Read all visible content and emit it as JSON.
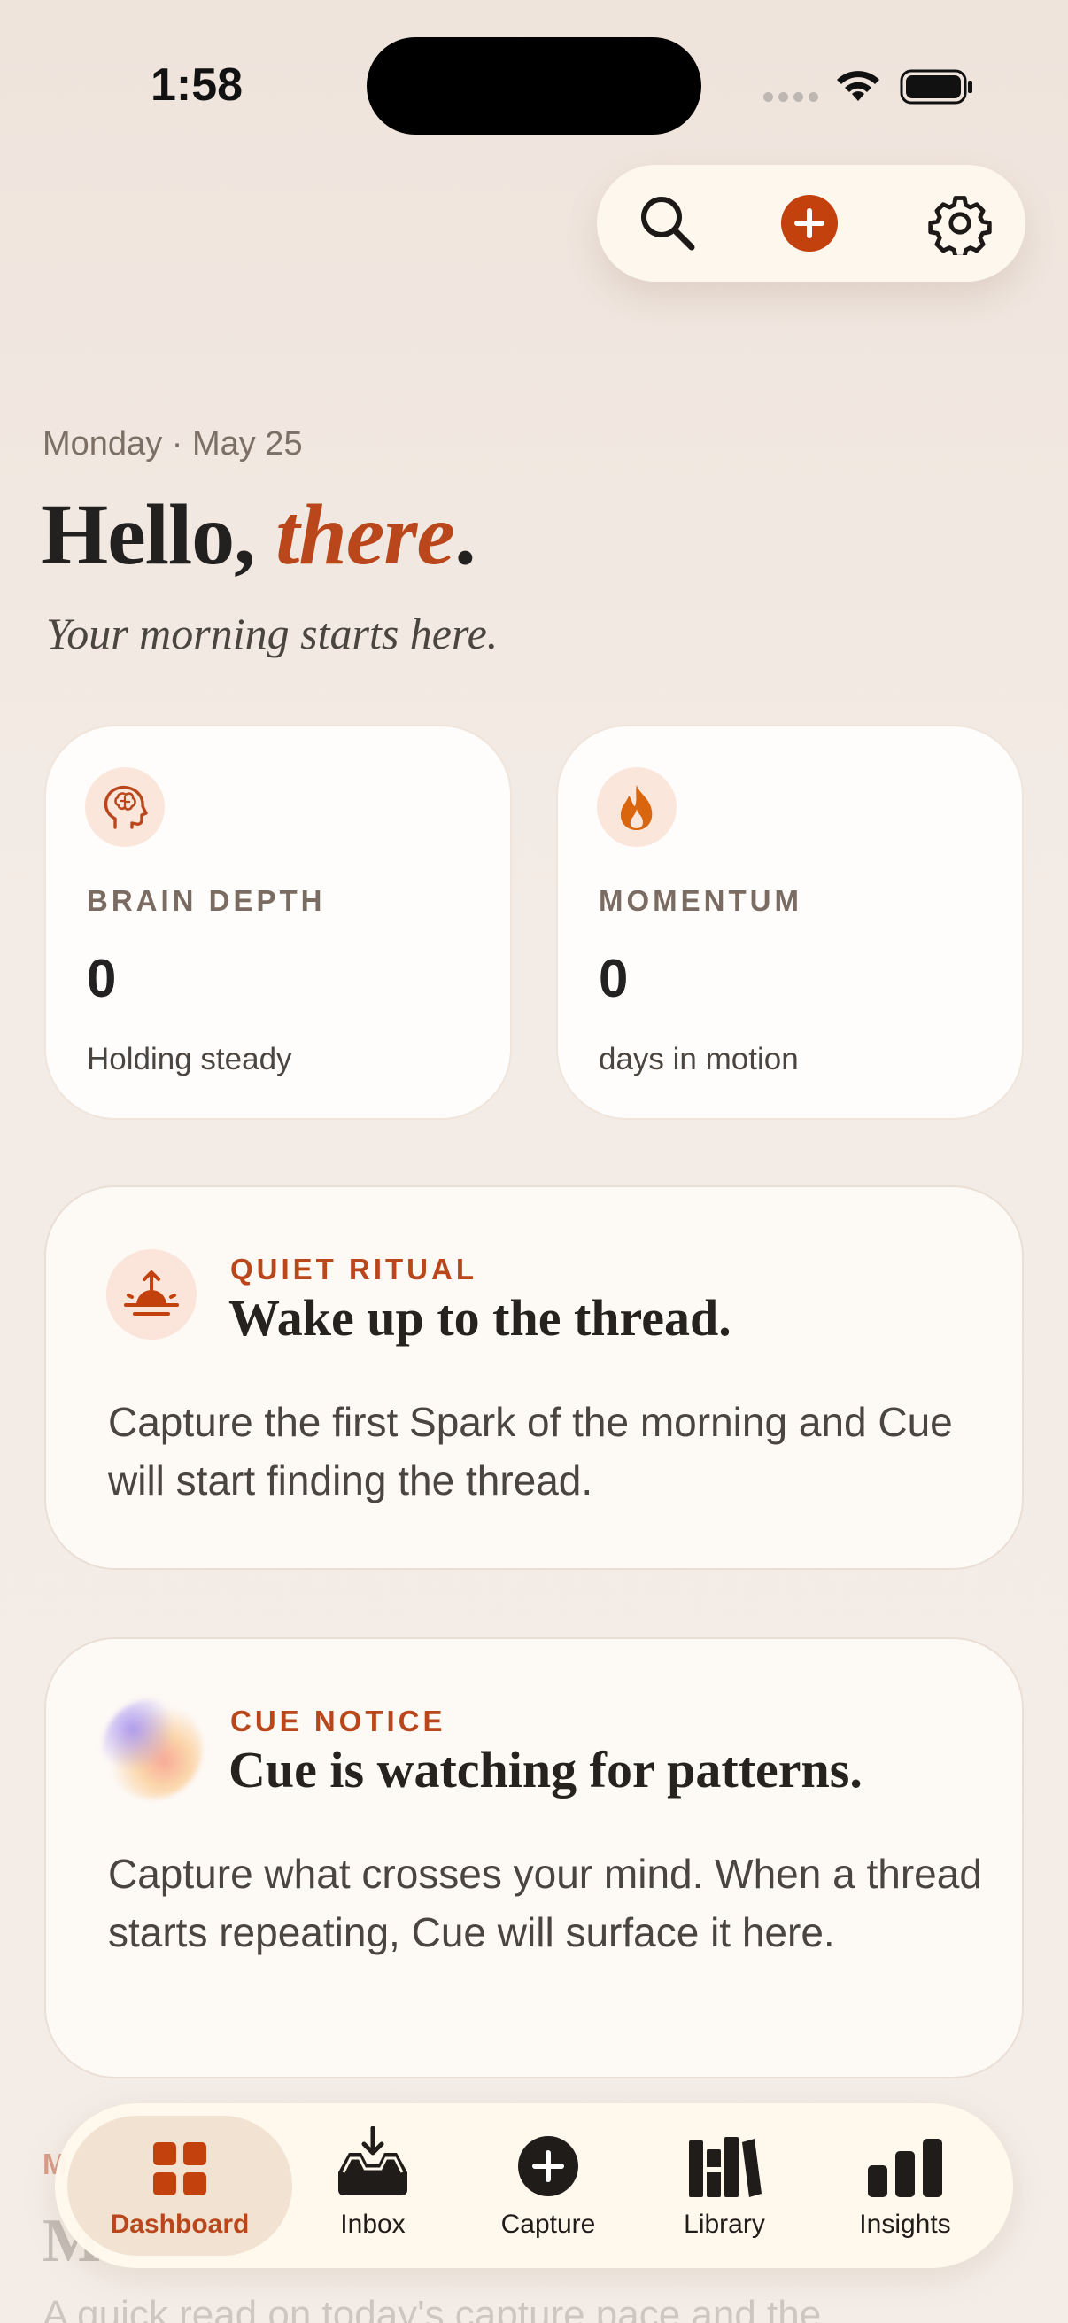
{
  "status_bar": {
    "time": "1:58"
  },
  "header": {
    "search_icon": "search-icon",
    "add_icon": "plus-circle-icon",
    "settings_icon": "gear-icon"
  },
  "greeting": {
    "date": "Monday · May 25",
    "hello_prefix": "Hello, ",
    "hello_name": "there",
    "hello_suffix": ".",
    "subtitle": "Your morning starts here."
  },
  "stats": [
    {
      "icon": "brain-head-icon",
      "label": "BRAIN DEPTH",
      "value": "0",
      "note": "Holding steady"
    },
    {
      "icon": "flame-icon",
      "label": "MOMENTUM",
      "value": "0",
      "note": "days in motion"
    }
  ],
  "cards": {
    "ritual": {
      "icon": "sunrise-icon",
      "kicker": "QUIET RITUAL",
      "title": "Wake up to the thread.",
      "body": "Capture the first Spark of the morning and Cue will start finding the thread."
    },
    "notice": {
      "icon": "cue-orb-icon",
      "kicker": "CUE NOTICE",
      "title": "Cue is watching for patterns.",
      "body": "Capture what crosses your mind. When a thread starts repeating, Cue will surface it here."
    }
  },
  "peek": {
    "kicker": "M",
    "title": "M",
    "body": "A quick read on today's capture pace and the"
  },
  "tabs": [
    {
      "label": "Dashboard",
      "icon": "grid-icon",
      "active": true
    },
    {
      "label": "Inbox",
      "icon": "inbox-tray-icon",
      "active": false
    },
    {
      "label": "Capture",
      "icon": "plus-circle-icon",
      "active": false
    },
    {
      "label": "Library",
      "icon": "books-icon",
      "active": false
    },
    {
      "label": "Insights",
      "icon": "bar-chart-icon",
      "active": false
    }
  ],
  "colors": {
    "accent": "#b9471b",
    "background": "#f3ebe5",
    "card": "#fffdfb"
  }
}
